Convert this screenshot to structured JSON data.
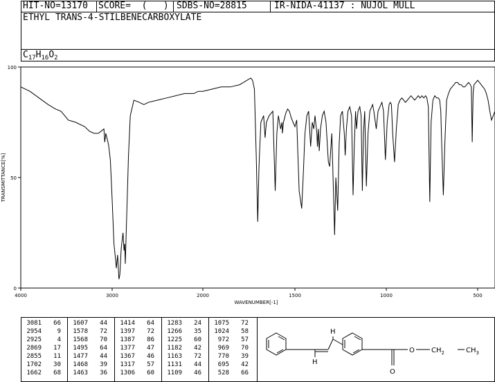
{
  "header": {
    "hit_no": "HIT-NO=13170",
    "score": "SCORE=  (   )",
    "sdbs_no": "SDBS-NO=28815",
    "method": "IR-NIDA-41137 : NUJOL MULL",
    "compound_name": "ETHYL TRANS-4-STILBENECARBOXYLATE",
    "formula": [
      {
        "t": "C",
        "sub": false
      },
      {
        "t": "17",
        "sub": true
      },
      {
        "t": "H",
        "sub": false
      },
      {
        "t": "16",
        "sub": true
      },
      {
        "t": "O",
        "sub": false
      },
      {
        "t": "2",
        "sub": true
      }
    ]
  },
  "chart_data": {
    "type": "line",
    "xlabel": "WAVENUMBER[-1]",
    "ylabel": "TRANSMITTANCE[%]",
    "xlim": [
      4000,
      400
    ],
    "ylim": [
      0,
      100
    ],
    "x_ticks": [
      "4000",
      "3000",
      "2000",
      "1500",
      "1000",
      "500"
    ],
    "y_ticks": [
      "0",
      "50",
      "100"
    ],
    "grid": false,
    "series": [
      {
        "x": [
          4000,
          3900,
          3800,
          3700,
          3620,
          3560,
          3520,
          3480,
          3400,
          3300,
          3250,
          3200,
          3150,
          3120,
          3090,
          3081,
          3070,
          3040,
          3020,
          3000,
          2980,
          2960,
          2954,
          2940,
          2925,
          2915,
          2900,
          2880,
          2869,
          2862,
          2855,
          2845,
          2820,
          2800,
          2760,
          2700,
          2650,
          2600,
          2500,
          2400,
          2300,
          2200,
          2100,
          2050,
          2000,
          1950,
          1900,
          1850,
          1800,
          1780,
          1760,
          1740,
          1730,
          1720,
          1710,
          1702,
          1695,
          1685,
          1670,
          1662,
          1655,
          1640,
          1620,
          1607,
          1598,
          1590,
          1578,
          1570,
          1568,
          1562,
          1550,
          1540,
          1530,
          1520,
          1510,
          1500,
          1490,
          1477,
          1468,
          1463,
          1455,
          1445,
          1435,
          1425,
          1414,
          1405,
          1397,
          1390,
          1380,
          1377,
          1372,
          1367,
          1360,
          1350,
          1340,
          1330,
          1317,
          1310,
          1306,
          1298,
          1288,
          1283,
          1276,
          1266,
          1258,
          1250,
          1240,
          1230,
          1225,
          1218,
          1210,
          1200,
          1190,
          1182,
          1175,
          1168,
          1163,
          1155,
          1145,
          1138,
          1131,
          1125,
          1118,
          1109,
          1100,
          1090,
          1080,
          1075,
          1068,
          1055,
          1045,
          1035,
          1024,
          1015,
          1005,
          995,
          985,
          978,
          972,
          965,
          955,
          945,
          935,
          925,
          915,
          905,
          895,
          885,
          875,
          865,
          855,
          845,
          835,
          825,
          815,
          805,
          795,
          785,
          778,
          770,
          762,
          755,
          745,
          735,
          725,
          715,
          708,
          702,
          695,
          688,
          680,
          670,
          660,
          650,
          640,
          630,
          620,
          610,
          600,
          590,
          580,
          570,
          560,
          550,
          540,
          535,
          530,
          528,
          525,
          520,
          510,
          500,
          490,
          480,
          470,
          460,
          450,
          440,
          430,
          420,
          410,
          400
        ],
        "y": [
          91,
          89,
          86,
          83,
          81,
          80,
          78,
          76,
          75,
          73,
          71,
          70,
          70,
          71,
          72,
          66,
          70,
          65,
          58,
          40,
          20,
          12,
          9,
          15,
          4,
          6,
          18,
          25,
          17,
          20,
          11,
          25,
          60,
          78,
          85,
          84,
          83,
          84,
          85,
          86,
          87,
          88,
          88,
          89,
          89,
          90,
          91,
          91,
          92,
          93,
          94,
          95,
          94,
          90,
          60,
          30,
          55,
          75,
          78,
          68,
          75,
          78,
          80,
          44,
          70,
          78,
          72,
          75,
          70,
          75,
          79,
          81,
          80,
          77,
          75,
          73,
          76,
          44,
          39,
          36,
          50,
          70,
          78,
          80,
          64,
          75,
          72,
          78,
          70,
          64,
          72,
          62,
          72,
          78,
          80,
          75,
          57,
          55,
          60,
          70,
          40,
          24,
          50,
          35,
          65,
          78,
          80,
          70,
          60,
          72,
          80,
          82,
          78,
          42,
          65,
          80,
          72,
          80,
          82,
          78,
          44,
          70,
          80,
          46,
          70,
          80,
          82,
          83,
          80,
          72,
          80,
          82,
          84,
          80,
          58,
          75,
          83,
          84,
          83,
          70,
          57,
          72,
          83,
          85,
          86,
          85,
          84,
          85,
          86,
          87,
          86,
          85,
          86,
          87,
          86,
          87,
          86,
          87,
          86,
          82,
          39,
          75,
          85,
          87,
          86,
          86,
          85,
          80,
          60,
          42,
          65,
          85,
          88,
          90,
          91,
          92,
          93,
          93,
          92,
          92,
          91,
          91,
          92,
          93,
          92,
          91,
          66,
          75,
          88,
          92,
          93,
          94,
          93,
          92,
          91,
          90,
          88,
          85,
          80,
          76,
          78,
          80
        ]
      }
    ]
  },
  "peak_table": {
    "columns": [
      [
        [
          "3081",
          "66"
        ],
        [
          "2954",
          "9"
        ],
        [
          "2925",
          "4"
        ],
        [
          "2869",
          "17"
        ],
        [
          "2855",
          "11"
        ],
        [
          "1702",
          "30"
        ],
        [
          "1662",
          "68"
        ]
      ],
      [
        [
          "1607",
          "44"
        ],
        [
          "1578",
          "72"
        ],
        [
          "1568",
          "70"
        ],
        [
          "1495",
          "64"
        ],
        [
          "1477",
          "44"
        ],
        [
          "1468",
          "39"
        ],
        [
          "1463",
          "36"
        ]
      ],
      [
        [
          "1414",
          "64"
        ],
        [
          "1397",
          "72"
        ],
        [
          "1387",
          "86"
        ],
        [
          "1377",
          "47"
        ],
        [
          "1367",
          "46"
        ],
        [
          "1317",
          "57"
        ],
        [
          "1306",
          "60"
        ]
      ],
      [
        [
          "1283",
          "24"
        ],
        [
          "1266",
          "35"
        ],
        [
          "1225",
          "60"
        ],
        [
          "1182",
          "42"
        ],
        [
          "1163",
          "72"
        ],
        [
          "1131",
          "44"
        ],
        [
          "1109",
          "46"
        ]
      ],
      [
        [
          "1075",
          "72"
        ],
        [
          "1024",
          "58"
        ],
        [
          "972",
          "57"
        ],
        [
          "969",
          "70"
        ],
        [
          "770",
          "39"
        ],
        [
          "695",
          "42"
        ],
        [
          "528",
          "66"
        ]
      ]
    ]
  },
  "structure": {
    "labels": {
      "h_top": "H",
      "h_bottom": "H",
      "o_carbonyl": "O",
      "o_ester": "O",
      "ch2": "CH",
      "ch2_sub": "2",
      "ch3": "CH",
      "ch3_sub": "3"
    }
  }
}
